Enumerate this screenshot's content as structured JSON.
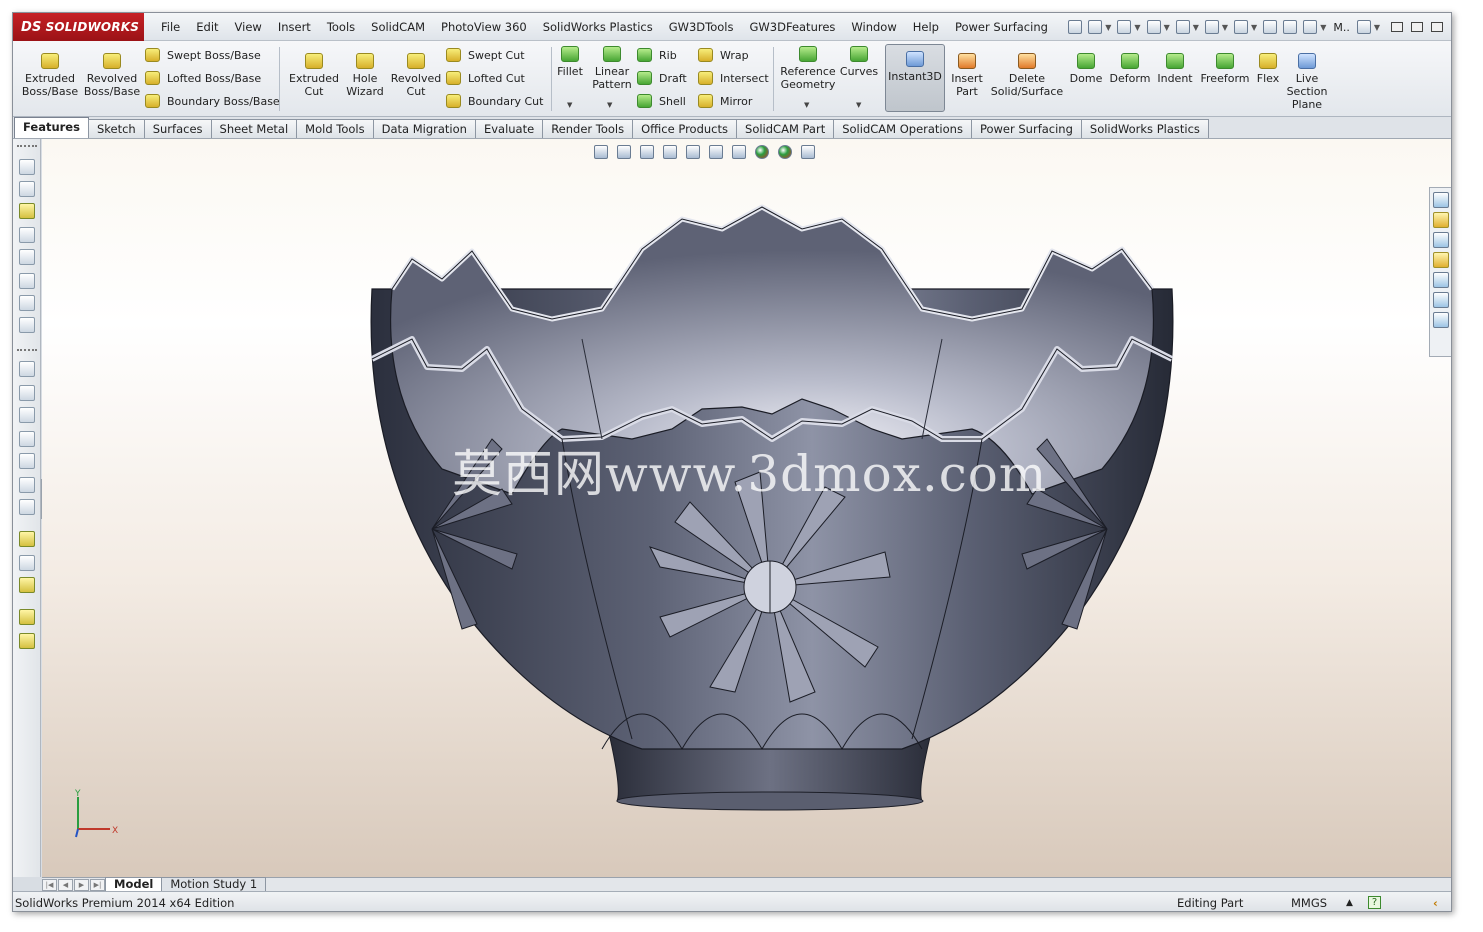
{
  "app": {
    "brand": "SOLIDWORKS",
    "brand_prefix": "DS",
    "accent": "#c62025"
  },
  "menu": [
    "File",
    "Edit",
    "View",
    "Insert",
    "Tools",
    "SolidCAM",
    "PhotoView 360",
    "SolidWorks Plastics",
    "GW3DTools",
    "GW3DFeatures",
    "Window",
    "Help",
    "Power Surfacing"
  ],
  "quick_access": {
    "search_text": "M.."
  },
  "ribbon": {
    "extruded_boss": "Extruded Boss/Base",
    "revolved_boss": "Revolved Boss/Base",
    "swept_boss": "Swept Boss/Base",
    "lofted_boss": "Lofted Boss/Base",
    "boundary_boss": "Boundary Boss/Base",
    "extruded_cut": "Extruded Cut",
    "hole_wizard": "Hole Wizard",
    "revolved_cut": "Revolved Cut",
    "swept_cut": "Swept Cut",
    "lofted_cut": "Lofted Cut",
    "boundary_cut": "Boundary Cut",
    "fillet": "Fillet",
    "linear_pattern": "Linear Pattern",
    "rib": "Rib",
    "draft": "Draft",
    "shell": "Shell",
    "wrap": "Wrap",
    "intersect": "Intersect",
    "mirror": "Mirror",
    "reference_geometry": "Reference Geometry",
    "curves": "Curves",
    "instant3d": "Instant3D",
    "insert_part": "Insert Part",
    "delete_solid": "Delete Solid/Surface",
    "dome": "Dome",
    "deform": "Deform",
    "indent": "Indent",
    "freeform": "Freeform",
    "flex": "Flex",
    "live_section": "Live Section Plane"
  },
  "tabs": [
    "Features",
    "Sketch",
    "Surfaces",
    "Sheet Metal",
    "Mold Tools",
    "Data Migration",
    "Evaluate",
    "Render Tools",
    "Office Products",
    "SolidCAM Part",
    "SolidCAM Operations",
    "Power Surfacing",
    "SolidWorks Plastics"
  ],
  "active_tab": "Features",
  "viewport": {
    "watermark": "莫西网www.3dmox.com",
    "triad_x": "X",
    "triad_y": "Y"
  },
  "bottom_tabs": [
    "Model",
    "Motion Study 1"
  ],
  "status": {
    "left": "SolidWorks Premium 2014 x64 Edition",
    "mode": "Editing Part",
    "units": "MMGS",
    "help": "?"
  },
  "icons": [
    "new-file-icon",
    "open-icon",
    "save-icon",
    "print-icon",
    "undo-icon",
    "select-icon",
    "rebuild-icon",
    "file-properties-icon",
    "options-icon",
    "help-icon",
    "zoom-to-fit-icon",
    "zoom-area-icon",
    "previous-view-icon",
    "section-view-icon",
    "view-orientation-icon",
    "display-style-icon",
    "hide-show-icon",
    "edit-appearance-icon",
    "apply-scene-icon",
    "view-settings-icon"
  ]
}
